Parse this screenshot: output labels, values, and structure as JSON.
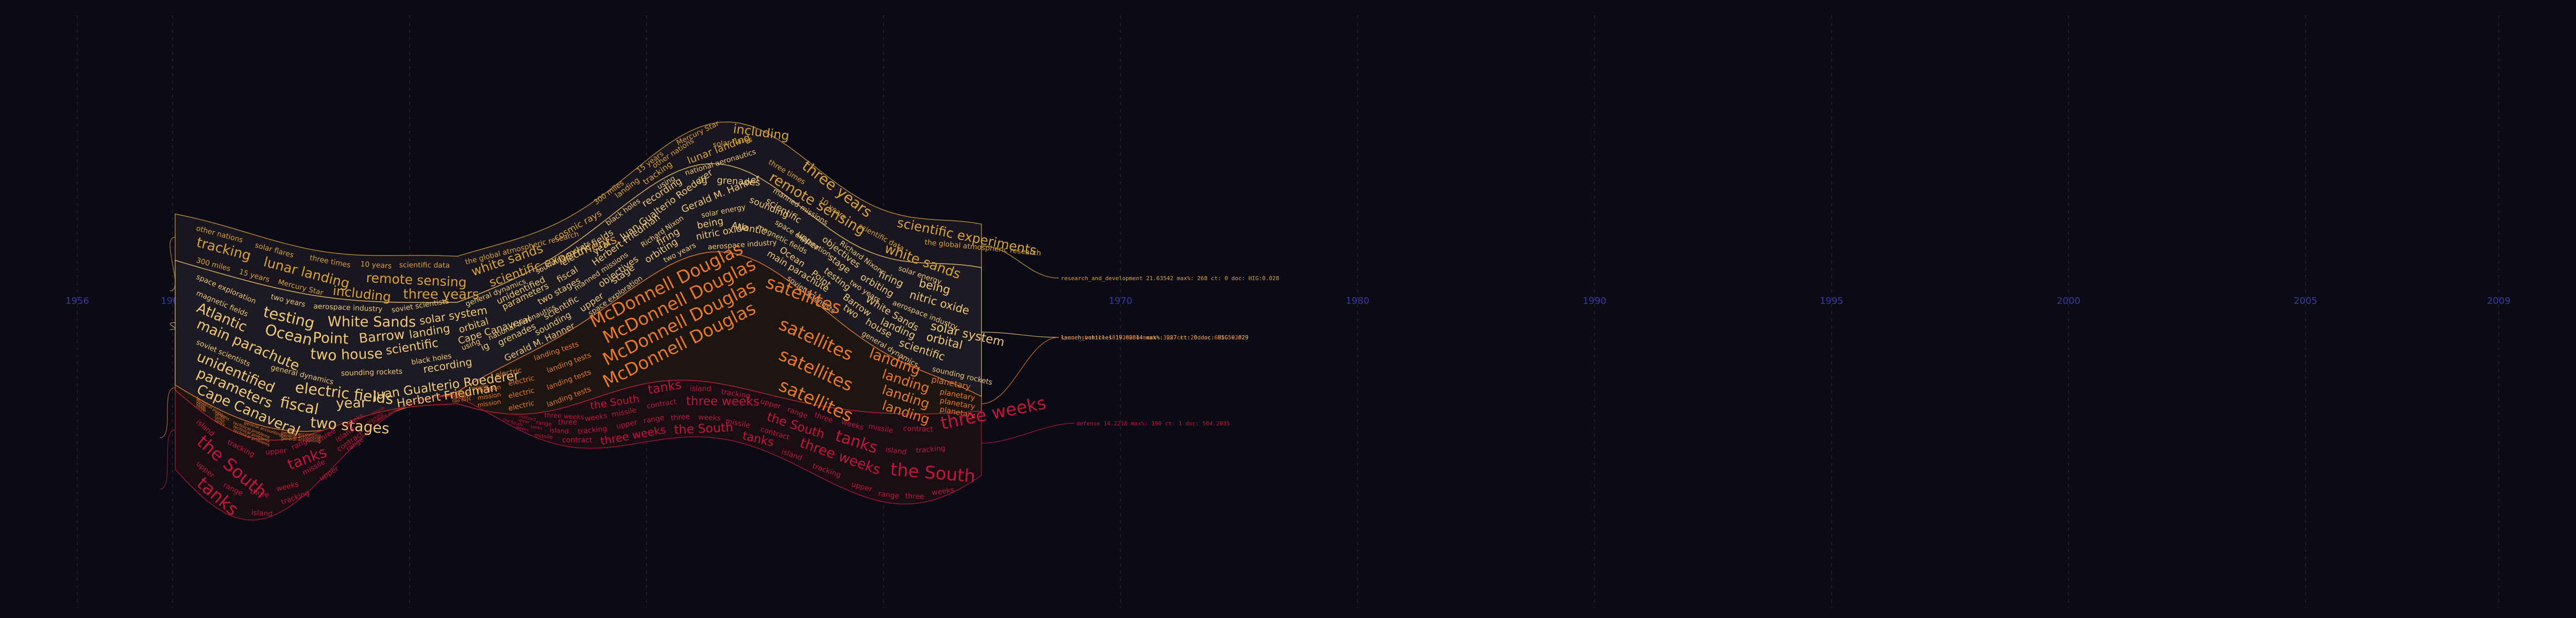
{
  "chart_data": {
    "type": "area",
    "title": "",
    "xlabel": "",
    "ylabel": "",
    "x_ticks": [
      "1956",
      "1960",
      "1970",
      "1980",
      "1990",
      "1995",
      "2000",
      "2005",
      "2009"
    ],
    "series": [
      {
        "name": "research_and_development",
        "color": "#d8a23a",
        "label": "research_and_development 21.63542 max%: 268 ct: 0 doc: HIG:0.028",
        "words_small": [
          "other nations",
          "solar flares",
          "three times",
          "10 years",
          "scientific data",
          "the global atmospheric research",
          "300 miles",
          "15 years",
          "Mercury Star"
        ],
        "words_large": [
          "including",
          "three years",
          "scientific experiments",
          "tracking",
          "lunar landing",
          "remote sensing",
          "white sands",
          "cosmic rays",
          "landing"
        ]
      },
      {
        "name": "launch_vehicles",
        "color": "#f0c878",
        "label": "launch_vehicles 19.62814 max%: 227 ct: 0 doc: HIG:0.029",
        "words_small": [
          "space exploration",
          "two years",
          "aerospace industry",
          "soviet scientists",
          "general dynamics",
          "sounding rockets",
          "black holes",
          "using",
          "national aeronautics",
          "manned missions",
          "Richard Nixon",
          "solar energy",
          "magnetic fields"
        ],
        "words_large": [
          "testing",
          "White Sands",
          "solar system",
          "unidentified",
          "electric fields",
          "recording",
          "ig",
          "grenades",
          "scientific",
          "objectives",
          "firing",
          "being",
          "Atlantic",
          "Ocean",
          "Point",
          "Barrow",
          "landing",
          "orbital",
          "parameters",
          "fiscal",
          "year",
          "Juan Gualterio Roederer",
          "sounding",
          "upper",
          "stage",
          "orbiting",
          "nitric oxide",
          "main parachute",
          "two",
          "house",
          "scientific",
          "Cape Canaveral",
          "two stages",
          "Herbert Friedman",
          "Gerald M. Hanner"
        ]
      },
      {
        "name": "space_shuttle",
        "color": "#e8782a",
        "label": "space_shuttle 18.730034 max%: 398 ct: 2 doc: 635.5935",
        "words_small": [
          "technical problems",
          "general accounting",
          "two days",
          "mission",
          "electric",
          "landing tests"
        ],
        "words_large": [
          "McDonnell Douglas",
          "satellites",
          "landing",
          "planetary",
          "three",
          "tanks"
        ]
      },
      {
        "name": "defense",
        "color": "#c0183c",
        "label": "defense 14.2218 max%: 190 ct: 1 doc: 504.2035",
        "words_small": [
          "island",
          "tracking",
          "upper",
          "range",
          "three",
          "weeks",
          "missile",
          "contract"
        ],
        "words_large": [
          "three weeks",
          "the South",
          "tanks"
        ]
      }
    ],
    "legend_position": "right",
    "grid": true
  }
}
